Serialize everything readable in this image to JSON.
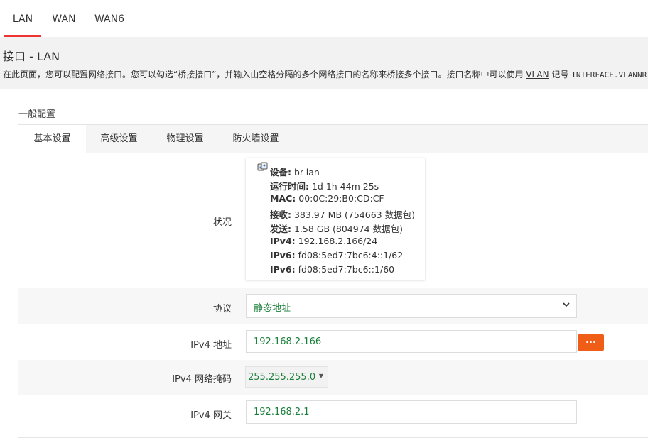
{
  "top_tabs": [
    {
      "label": "LAN",
      "active": true
    },
    {
      "label": "WAN",
      "active": false
    },
    {
      "label": "WAN6",
      "active": false
    }
  ],
  "page": {
    "title": "接口 - LAN",
    "desc_before": "在此页面，您可以配置网络接口。您可以勾选“桥接接口”，并输入由空格分隔的多个网络接口的名称来桥接多个接口。接口名称中可以使用 ",
    "desc_link": "VLAN",
    "desc_after": " 记号 ",
    "desc_code": "INTERFACE.VLANNR"
  },
  "section_title": "一般配置",
  "sub_tabs": [
    {
      "label": "基本设置",
      "active": true
    },
    {
      "label": "高级设置",
      "active": false
    },
    {
      "label": "物理设置",
      "active": false
    },
    {
      "label": "防火墙设置",
      "active": false
    }
  ],
  "status": {
    "label": "状况",
    "icon": "network-device-icon",
    "lines": [
      {
        "key": "设备:",
        "value": " br-lan"
      },
      {
        "key": "运行时间:",
        "value": " 1d 1h 44m 25s"
      },
      {
        "key": "MAC:",
        "value": " 00:0C:29:B0:CD:CF"
      },
      {
        "key": "接收:",
        "value": " 383.97 MB (754663 数据包)"
      },
      {
        "key": "发送:",
        "value": " 1.58 GB (804974 数据包)"
      },
      {
        "key": "IPv4:",
        "value": " 192.168.2.166/24"
      },
      {
        "key": "IPv6:",
        "value": " fd08:5ed7:7bc6:4::1/62"
      },
      {
        "key": "IPv6:",
        "value": " fd08:5ed7:7bc6::1/60"
      }
    ]
  },
  "protocol": {
    "label": "协议",
    "value": "静态地址"
  },
  "ipv4_address": {
    "label": "IPv4 地址",
    "value": "192.168.2.166",
    "button": "..."
  },
  "ipv4_netmask": {
    "label": "IPv4 网络掩码",
    "value": "255.255.255.0"
  },
  "ipv4_gateway": {
    "label": "IPv4 网关",
    "value": "192.168.2.1"
  },
  "colors": {
    "accent": "#e33333",
    "button": "#f05d16",
    "value_text": "#1a7f3a"
  }
}
